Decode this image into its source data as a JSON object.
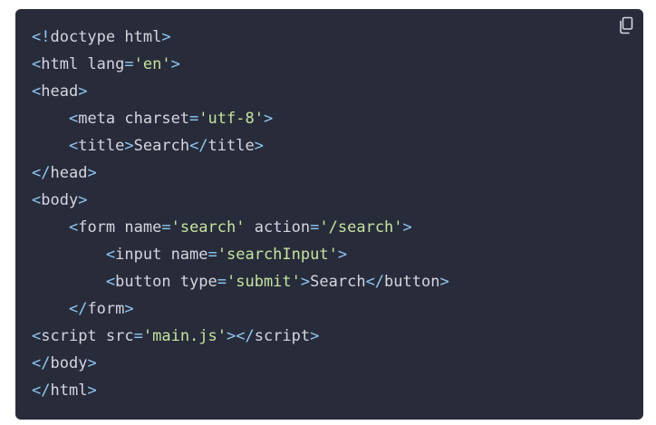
{
  "code_block": {
    "copy_icon": "copy-icon",
    "colors": {
      "background": "#282c3a",
      "punctuation": "#8fc8f2",
      "tag": "#d3d6de",
      "string": "#c6e3a0",
      "text": "#d3d6de"
    },
    "lines": [
      [
        {
          "t": "punct",
          "v": "<!"
        },
        {
          "t": "tag",
          "v": "doctype html"
        },
        {
          "t": "punct",
          "v": ">"
        }
      ],
      [
        {
          "t": "punct",
          "v": "<"
        },
        {
          "t": "tag",
          "v": "html "
        },
        {
          "t": "attr",
          "v": "lang"
        },
        {
          "t": "punct",
          "v": "="
        },
        {
          "t": "str",
          "v": "'en'"
        },
        {
          "t": "punct",
          "v": ">"
        }
      ],
      [
        {
          "t": "punct",
          "v": "<"
        },
        {
          "t": "tag",
          "v": "head"
        },
        {
          "t": "punct",
          "v": ">"
        }
      ],
      [
        {
          "t": "text",
          "v": "    "
        },
        {
          "t": "punct",
          "v": "<"
        },
        {
          "t": "tag",
          "v": "meta "
        },
        {
          "t": "attr",
          "v": "charset"
        },
        {
          "t": "punct",
          "v": "="
        },
        {
          "t": "str",
          "v": "'utf-8'"
        },
        {
          "t": "punct",
          "v": ">"
        }
      ],
      [
        {
          "t": "text",
          "v": "    "
        },
        {
          "t": "punct",
          "v": "<"
        },
        {
          "t": "tag",
          "v": "title"
        },
        {
          "t": "punct",
          "v": ">"
        },
        {
          "t": "text",
          "v": "Search"
        },
        {
          "t": "punct",
          "v": "</"
        },
        {
          "t": "tag",
          "v": "title"
        },
        {
          "t": "punct",
          "v": ">"
        }
      ],
      [
        {
          "t": "punct",
          "v": "</"
        },
        {
          "t": "tag",
          "v": "head"
        },
        {
          "t": "punct",
          "v": ">"
        }
      ],
      [
        {
          "t": "punct",
          "v": "<"
        },
        {
          "t": "tag",
          "v": "body"
        },
        {
          "t": "punct",
          "v": ">"
        }
      ],
      [
        {
          "t": "text",
          "v": "    "
        },
        {
          "t": "punct",
          "v": "<"
        },
        {
          "t": "tag",
          "v": "form "
        },
        {
          "t": "attr",
          "v": "name"
        },
        {
          "t": "punct",
          "v": "="
        },
        {
          "t": "str",
          "v": "'search'"
        },
        {
          "t": "text",
          "v": " "
        },
        {
          "t": "attr",
          "v": "action"
        },
        {
          "t": "punct",
          "v": "="
        },
        {
          "t": "str",
          "v": "'/search'"
        },
        {
          "t": "punct",
          "v": ">"
        }
      ],
      [
        {
          "t": "text",
          "v": "        "
        },
        {
          "t": "punct",
          "v": "<"
        },
        {
          "t": "tag",
          "v": "input "
        },
        {
          "t": "attr",
          "v": "name"
        },
        {
          "t": "punct",
          "v": "="
        },
        {
          "t": "str",
          "v": "'searchInput'"
        },
        {
          "t": "punct",
          "v": ">"
        }
      ],
      [
        {
          "t": "text",
          "v": "        "
        },
        {
          "t": "punct",
          "v": "<"
        },
        {
          "t": "tag",
          "v": "button "
        },
        {
          "t": "attr",
          "v": "type"
        },
        {
          "t": "punct",
          "v": "="
        },
        {
          "t": "str",
          "v": "'submit'"
        },
        {
          "t": "punct",
          "v": ">"
        },
        {
          "t": "text",
          "v": "Search"
        },
        {
          "t": "punct",
          "v": "</"
        },
        {
          "t": "tag",
          "v": "button"
        },
        {
          "t": "punct",
          "v": ">"
        }
      ],
      [
        {
          "t": "text",
          "v": "    "
        },
        {
          "t": "punct",
          "v": "</"
        },
        {
          "t": "tag",
          "v": "form"
        },
        {
          "t": "punct",
          "v": ">"
        }
      ],
      [
        {
          "t": "punct",
          "v": "<"
        },
        {
          "t": "tag",
          "v": "script "
        },
        {
          "t": "attr",
          "v": "src"
        },
        {
          "t": "punct",
          "v": "="
        },
        {
          "t": "str",
          "v": "'main.js'"
        },
        {
          "t": "punct",
          "v": "></"
        },
        {
          "t": "tag",
          "v": "script"
        },
        {
          "t": "punct",
          "v": ">"
        }
      ],
      [
        {
          "t": "punct",
          "v": "</"
        },
        {
          "t": "tag",
          "v": "body"
        },
        {
          "t": "punct",
          "v": ">"
        }
      ],
      [
        {
          "t": "punct",
          "v": "</"
        },
        {
          "t": "tag",
          "v": "html"
        },
        {
          "t": "punct",
          "v": ">"
        }
      ]
    ]
  }
}
